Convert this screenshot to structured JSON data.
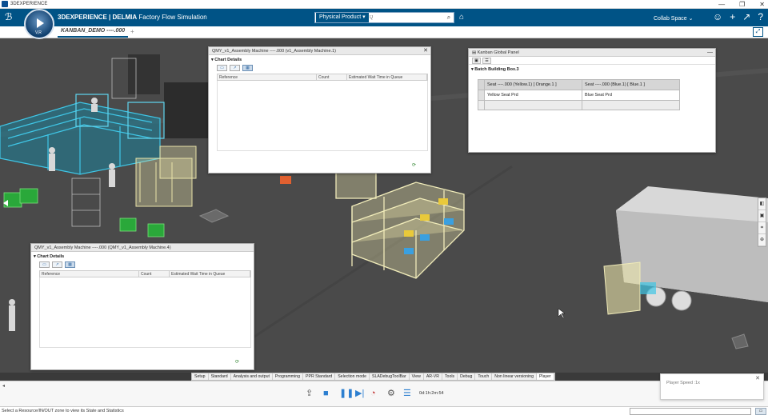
{
  "window": {
    "title": "3DEXPERIENCE",
    "controls": [
      "—",
      "❐",
      "✕"
    ]
  },
  "topbar": {
    "brand_bold": "3DEXPERIENCE | DELMIA",
    "brand_rest": " Factory Flow Simulation",
    "compass_label": "V,R",
    "search_context": "Physical Product ▾",
    "search_placeholder": "Q",
    "collab_space": "Collab Space ⌄",
    "icons": [
      "user-icon",
      "plus-icon",
      "share-icon",
      "help-icon"
    ]
  },
  "tabs": {
    "active": "KANBAN_DEMO ----.000",
    "add": "+"
  },
  "panel_machine1": {
    "title": "QMY_v1_Assembly Machine ----.000 (v1_Assembly Machine.1)",
    "section": "▾ Chart Details",
    "columns": [
      "Reference",
      "Count",
      "Estimated Wait Time in Queue"
    ]
  },
  "panel_machine4": {
    "title": "QMY_v1_Assembly Machine ----.000 (QMY_v1_Assembly Machine.4)",
    "section": "▾ Chart Details",
    "columns": [
      "Reference",
      "Count",
      "Estimated Wait Time in Queue"
    ]
  },
  "kanban_panel": {
    "title": "Kanban Global Panel",
    "minimize": "—",
    "section": "▾ Batch Building Box.3",
    "headers": [
      "Seat ----.000 (Yellow.1) [ Orange.1 ]",
      "Seat ----.000 (Blue.1) [ Blue.1 ]"
    ],
    "row1": [
      "Yellow Seat Prd",
      "Blue Seat Prd"
    ]
  },
  "app_tabs": {
    "items": [
      "Setup",
      "Standard",
      "Analysis and output",
      "Programming",
      "PPR Standard",
      "Selection mode",
      "SLADebugToolBar",
      "View",
      "AR-VR",
      "Tools",
      "Debug",
      "Touch",
      "Non linear versioning",
      "Player"
    ],
    "active_index": 13
  },
  "player": {
    "time": "0d:1h:2m:54",
    "speed_label": "Player Speed :1x",
    "speed_close": "✕"
  },
  "status": {
    "message": "Select a Resource/IN/OUT zone to view its State and Statistics"
  },
  "colors": {
    "brand_blue": "#005386",
    "cyan_conveyor": "#3fc6e6",
    "wireframe_yellow": "#e9e3a8",
    "green_bins": "#2aa83a"
  }
}
